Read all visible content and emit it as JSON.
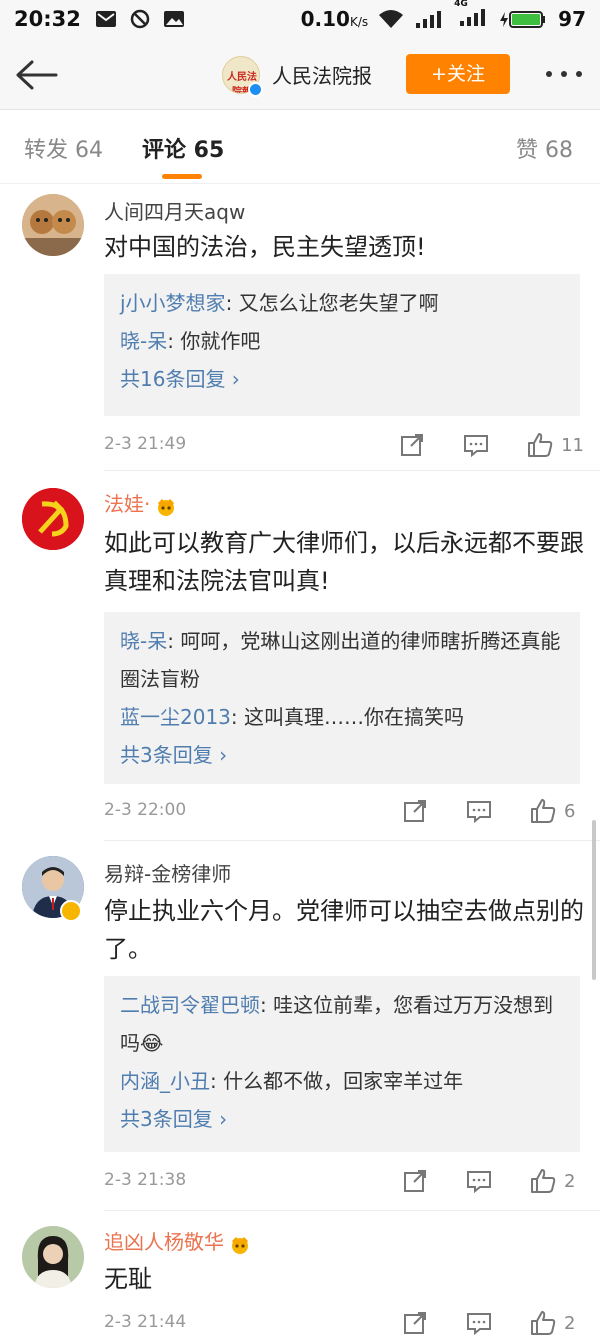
{
  "status_bar": {
    "time": "20:32",
    "net_speed": "0.10",
    "net_unit": "K/s",
    "network": "4G",
    "battery": "97"
  },
  "nav": {
    "title": "人民法院报",
    "avatar_text": "人民法院報",
    "follow_label": "+关注",
    "accent": "#ff8200"
  },
  "tabs": {
    "repost": "转发 64",
    "comments": "评论 65",
    "likes": "赞 68"
  },
  "comments": [
    {
      "user": "人间四月天aqw",
      "text": "对中国的法治，民主失望透顶!",
      "replies": [
        {
          "name": "j小小梦想家",
          "text": ": 又怎么让您老失望了啊"
        },
        {
          "name": "晓-呆",
          "text": ": 你就作吧"
        }
      ],
      "more": "共16条回复 ›",
      "time": "2-3 21:49",
      "likes": "11"
    },
    {
      "user": "法娃·",
      "text": "如此可以教育广大律师们，以后永远都不要跟真理和法院法官叫真!",
      "replies": [
        {
          "name": "晓-呆",
          "text": ": 呵呵，党琳山这刚出道的律师瞎折腾还真能圈法盲粉"
        },
        {
          "name": "蓝一尘2013",
          "text": ": 这叫真理……你在搞笑吗"
        }
      ],
      "more": "共3条回复 ›",
      "time": "2-3 22:00",
      "likes": "6"
    },
    {
      "user": "易辩-金榜律师",
      "text": "停止执业六个月。党律师可以抽空去做点别的了。",
      "replies": [
        {
          "name": "二战司令翟巴顿",
          "text": ": 哇这位前辈，您看过万万没想到吗😂"
        },
        {
          "name": "内涵_小丑",
          "text": ": 什么都不做，回家宰羊过年"
        }
      ],
      "more": "共3条回复 ›",
      "time": "2-3 21:38",
      "likes": "2"
    },
    {
      "user": "追凶人杨敬华",
      "text": "无耻",
      "time": "2-3 21:44",
      "likes": "2"
    }
  ],
  "icons": {
    "back": "back-arrow-icon",
    "more": "more-dots-icon",
    "repost": "repost-icon",
    "comment": "comment-icon",
    "like": "thumbs-up-icon"
  }
}
